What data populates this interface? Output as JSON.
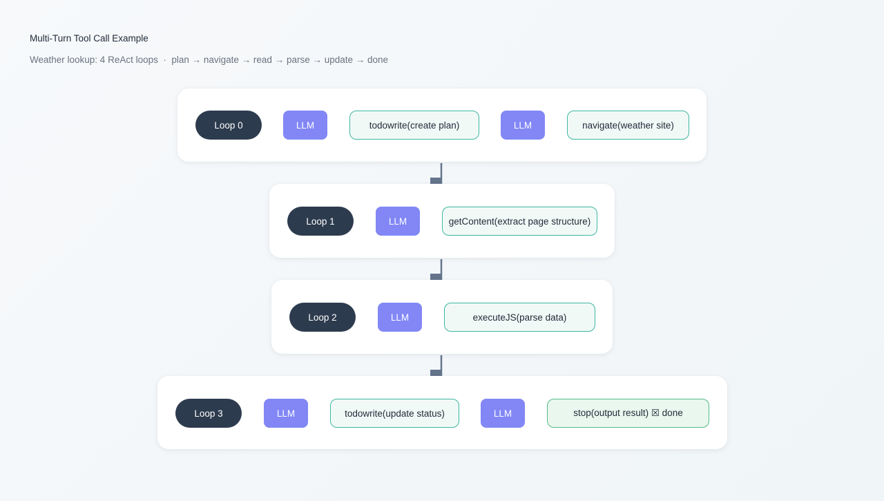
{
  "header": {
    "title": "Multi-Turn Tool Call Example",
    "subtitle": "Weather lookup: 4 ReAct loops  ·  plan → navigate → read → parse → update → done"
  },
  "loops": [
    {
      "label": "Loop 0",
      "steps": [
        {
          "kind": "llm",
          "label": "LLM"
        },
        {
          "kind": "tool",
          "label": "todowrite(create plan)"
        },
        {
          "kind": "llm",
          "label": "LLM"
        },
        {
          "kind": "tool",
          "label": "navigate(weather site)"
        }
      ]
    },
    {
      "label": "Loop 1",
      "steps": [
        {
          "kind": "llm",
          "label": "LLM"
        },
        {
          "kind": "tool",
          "label": "getContent(extract page structure)"
        }
      ]
    },
    {
      "label": "Loop 2",
      "steps": [
        {
          "kind": "llm",
          "label": "LLM"
        },
        {
          "kind": "tool",
          "label": "executeJS(parse data)"
        }
      ]
    },
    {
      "label": "Loop 3",
      "steps": [
        {
          "kind": "llm",
          "label": "LLM"
        },
        {
          "kind": "tool",
          "label": "todowrite(update status)"
        },
        {
          "kind": "llm",
          "label": "LLM"
        },
        {
          "kind": "tool-done",
          "label": "stop(output result) ☒ done"
        }
      ]
    }
  ],
  "colors": {
    "loop_node": "#2d3b4e",
    "llm_node": "#8287f5",
    "tool_border": "#3db6a0",
    "done_fill": "#e9f7ee",
    "connector": "#64748b"
  }
}
